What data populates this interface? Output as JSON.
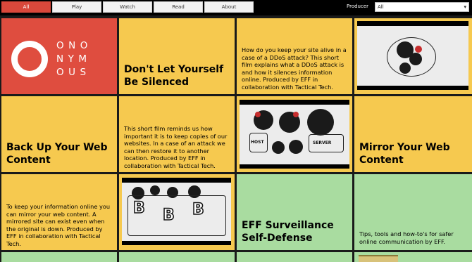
{
  "nav": {
    "tabs": [
      {
        "label": "All",
        "active": true
      },
      {
        "label": "Play",
        "active": false
      },
      {
        "label": "Watch",
        "active": false
      },
      {
        "label": "Read",
        "active": false
      },
      {
        "label": "About",
        "active": false
      }
    ],
    "producer_label": "Producer",
    "producer_value": "All"
  },
  "tiles": {
    "logo_lines": [
      "ONO",
      "NYM",
      "OUS"
    ],
    "t1_title": "Don't Let Yourself Be Silenced",
    "t2_desc": "How do you keep your site alive in a case of a DDoS attack? This short film explains what a DDoS attack is and how it silences information online. Produced by EFF in collaboration with Tactical Tech.",
    "t4_title": "Back Up Your Web Content",
    "t5_desc": "This short film reminds us how important it is to keep copies of our websites. In a case of an attack we can then restore it to another location. Produced by EFF in collaboration with Tactical Tech.",
    "t6_labels": [
      "HOST",
      "SERVER"
    ],
    "t7_title": "Mirror Your Web Content",
    "t8_desc": "To keep your information online you can mirror your web content. A mirrored site can exist even when the original is down. Produced by EFF in collaboration with Tactical Tech.",
    "t9_letters": [
      "B",
      "B",
      "B"
    ],
    "t10_title": "EFF Surveillance Self-Defense",
    "t11_desc": "Tips, tools and how-to's for safer online communication by EFF."
  },
  "colors": {
    "red": "#df4d3f",
    "yellow": "#f6c94f",
    "green": "#a9dca0",
    "nav_active": "#d9483b"
  }
}
